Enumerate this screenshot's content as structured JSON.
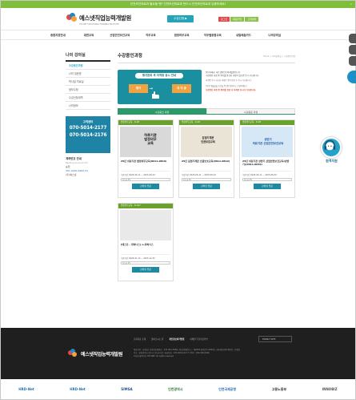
{
  "topbar": {
    "text": "인천보건의료과 필요할 땐? 인천보건의료과 반드시 인천보건의료과 유용하세요!",
    "close": "×"
  },
  "header": {
    "logo_text": "예스넷직업능력개발원",
    "logo_sub": "YES NET VOCATIONAL TRAINING INSTITUTE",
    "course_button": "수강신청 ▶",
    "util": [
      {
        "label": "로그인",
        "color": "#e5464a"
      },
      {
        "label": "회원가입",
        "color": "#8bc34a"
      },
      {
        "label": "고객센터",
        "color": "#8bc34a"
      }
    ]
  },
  "gnb": [
    "종합지원안내",
    "대면교육",
    "산업안전보건교육",
    "직무교육",
    "법정의무교육",
    "직무별종합교육",
    "내일배움카드",
    "나의강의실"
  ],
  "lnb": {
    "title": "나의 강의실",
    "items": [
      "수강중인과정",
      "나의 질문방",
      "학사일 처료실",
      "정보수정",
      "수강신청내역",
      "나의정보"
    ],
    "active_index": 0
  },
  "call": {
    "title": "고객센터",
    "numbers": [
      "070-5014-2177",
      "070-5014-2176"
    ]
  },
  "account": {
    "heading": "계좌번호 안내",
    "sub": "Banking Account Info.",
    "bank": "농협",
    "number": "301-0220-0462-51",
    "holder": "(주)예스넷"
  },
  "content": {
    "title": "수강중인과정",
    "breadcrumb": "Home > 나의강의실 > 수강중인과정"
  },
  "intro": {
    "pill": "평가완료 후 자격증 응시 안내",
    "btn1": "평가",
    "btn2": "자 격 증",
    "arrow": "→",
    "desc1": "안녕하세요, 예스넷직업능력개발원입니다.",
    "desc2": "수강중인 과정 중 평가를 완료한 과정이 있으면 응시 가능합니다.",
    "desc3": "자격증 응시 가능한 과정은 평가 완료 후 응시 가능합니다.",
    "caption": "(자격 제출물을 조건을 5단원 확인하고 신청하세요.)",
    "red": "수강중인 과정 중 평가를 완료 후 자격증 응시가 가능합니다."
  },
  "tabs": [
    {
      "label": "수강중인 과정",
      "active": true
    },
    {
      "label": "수강종료 과정",
      "active": false
    }
  ],
  "cards": [
    {
      "category": "법정의무교육 · D-28",
      "thumb_text": "하루기관\n법정의무\n교육",
      "title": "25년 의료기관 법정의무교육(0611-0810)",
      "period": "수강기간 2025-06-11 ~ 2025-08-10",
      "progress_label": "진도율 0%",
      "progress": 0,
      "button": "강의실 입장"
    },
    {
      "category": "법정의무교육 · D-28",
      "thumb_text": "감염기계관\n인권보호교육",
      "title": "25년 감염기계관 인권보호교육(0611-0810)",
      "period": "수강기간 2025-06-11 ~ 2025-08-10",
      "progress_label": "진도율 0%",
      "progress": 0,
      "button": "강의실 입장"
    },
    {
      "category": "법정의무교육 · D-28",
      "thumb_text": "상반기\n의료기관 산업안전보건교육",
      "title": "25년 의료기관 상반기 산업안전보건교육(상반기)(0611-0630)",
      "period": "수강기간 2025-06-11 ~ 2025-06-30",
      "progress_label": "진도율 0%",
      "progress": 0,
      "button": "강의실 입장"
    },
    {
      "category": "법정의무교육 · D-197",
      "thumb_text": "",
      "title": "[테스트 - 위하나스] e-위하나스",
      "period": "수강기간 2025-01-13 ~ 2025-12-31",
      "progress_label": "진도율 0%",
      "progress": 0,
      "button": "강의실 입장"
    }
  ],
  "floating": {
    "label": "원격지원"
  },
  "footer": {
    "nav": [
      "교육목표 소개",
      "찾아오시는 길",
      "개인정보처리방침",
      "이메일 무단수집거부"
    ],
    "family": "FAMILY SITE",
    "logo": "예스넷직업능력개발원",
    "info1": "대표이사 : 한정희 | 사업자등록번호 : 121-86-13568 | 통신판매업신고 : 제2020-인천연수-0000호 | 개인정보관리책임자 : 한정희",
    "info2": "주소 : 인천광역시 연수구 송도과학로 | 대표번호 : 070-5014-2177 | FAX : 032-000-0000",
    "info3": "Copyright (C) YES NET. All rights reserved."
  },
  "partners": [
    {
      "label": "HRD-Net",
      "color": "#2a6fb1"
    },
    {
      "label": "HRD-Net",
      "color": "#2a6fb1"
    },
    {
      "label": "SIMSA",
      "color": "#1e4f8d"
    },
    {
      "label": "인천광역시",
      "color": "#2a7a3e"
    },
    {
      "label": "인천국제공항",
      "color": "#2a6fb1"
    },
    {
      "label": "고용노동부",
      "color": "#333333"
    },
    {
      "label": "INNOBIZ",
      "color": "#555555"
    }
  ]
}
